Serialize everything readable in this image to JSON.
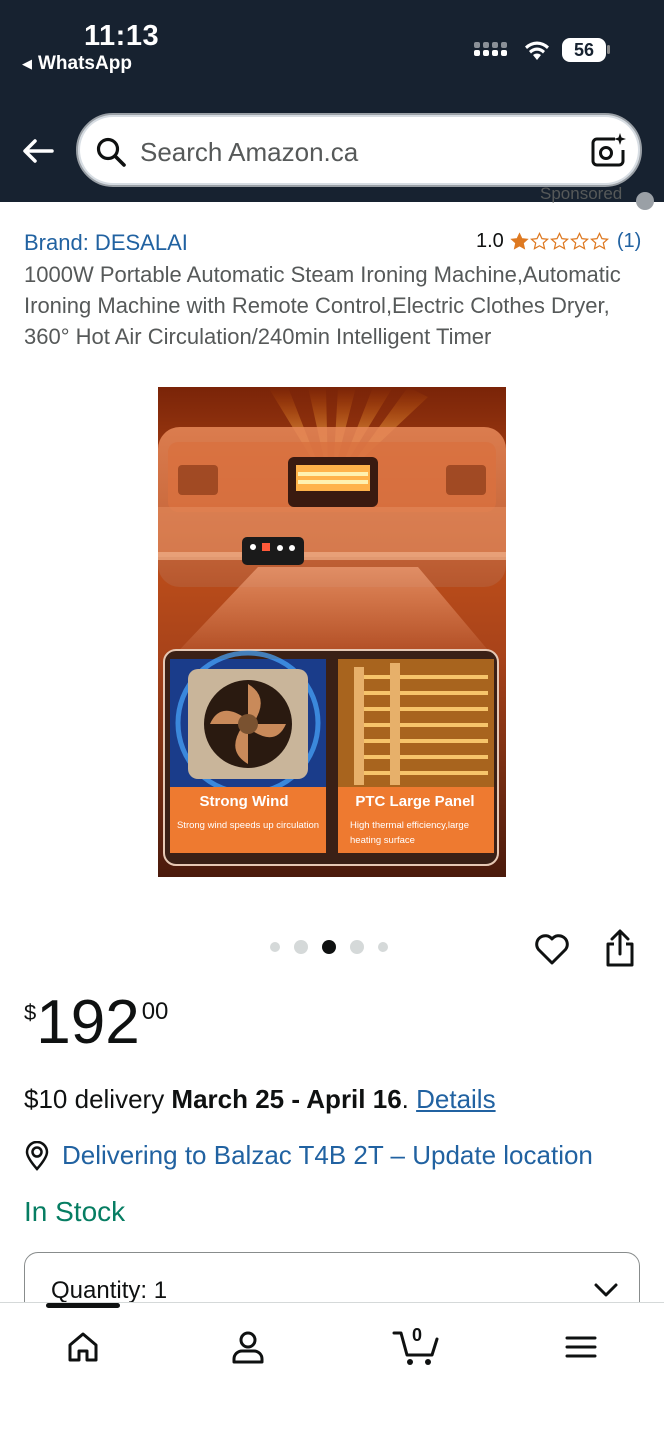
{
  "status_bar": {
    "time": "11:13",
    "back_app": "WhatsApp",
    "battery": "56"
  },
  "search": {
    "placeholder": "Search Amazon.ca"
  },
  "product": {
    "sponsored_label": "Sponsored",
    "brand": "Brand: DESALAI",
    "rating_value": "1.0",
    "rating_stars": 1,
    "rating_count": "(1)",
    "title": "1000W Portable Automatic Steam Ironing Machine,Automatic Ironing Machine with Remote Control,Electric Clothes Dryer, 360° Hot Air Circulation/240min Intelligent Timer",
    "image": {
      "panel_left_title": "Strong Wind",
      "panel_left_sub": "Strong wind speeds up circulation",
      "panel_right_title": "PTC Large Panel",
      "panel_right_sub_1": "High thermal efficiency,large",
      "panel_right_sub_2": "heating surface"
    },
    "carousel": {
      "count": 5,
      "active_index": 2
    },
    "price": {
      "symbol": "$",
      "whole": "192",
      "fraction": "00"
    },
    "delivery": {
      "prefix": "$10 delivery ",
      "dates": "March 25 - April 16",
      "suffix": ". ",
      "details_link": "Details"
    },
    "location": "Delivering to Balzac T4B 2T – Update location",
    "stock": "In Stock",
    "quantity": "Quantity: 1"
  },
  "bottom_nav": {
    "cart_count": "0",
    "items": [
      "home-icon",
      "account-icon",
      "cart-icon",
      "menu-icon"
    ]
  },
  "colors": {
    "header_bg": "#172230",
    "link": "#2162a1",
    "stock_green": "#067d62",
    "star": "#de7921"
  }
}
